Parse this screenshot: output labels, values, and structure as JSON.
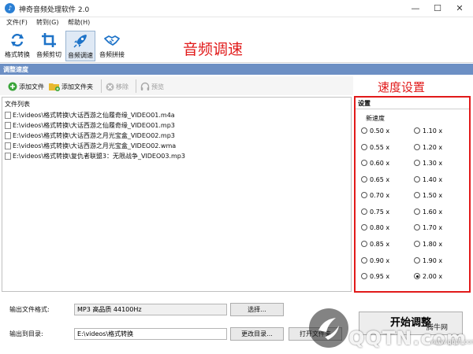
{
  "window": {
    "title": "神奇音频处理软件 2.0",
    "minimize": "—",
    "maximize": "☐",
    "close": "✕"
  },
  "menu": [
    "文件(F)",
    "转到(G)",
    "帮助(H)"
  ],
  "toolbar": {
    "tools": [
      {
        "label": "格式转换",
        "icon": "convert-icon"
      },
      {
        "label": "音频剪切",
        "icon": "crop-icon"
      },
      {
        "label": "音频调速",
        "icon": "rocket-icon",
        "active": true
      },
      {
        "label": "音频拼接",
        "icon": "handshake-icon"
      }
    ]
  },
  "annotations": {
    "title": "音频调速",
    "speed": "速度设置",
    "color": "#e11a1a"
  },
  "section": {
    "title": "调整速度"
  },
  "file_toolbar": {
    "add_file": "添加文件",
    "add_folder": "添加文件夹",
    "remove": "移除",
    "preview": "预览"
  },
  "file_list": {
    "header": "文件列表",
    "files": [
      "E:\\videos\\格式转换\\大话西游之仙履奇缘_VIDEO01.m4a",
      "E:\\videos\\格式转换\\大话西游之仙履奇缘_VIDEO01.mp3",
      "E:\\videos\\格式转换\\大话西游之月光宝盒_VIDEO02.mp3",
      "E:\\videos\\格式转换\\大话西游之月光宝盒_VIDEO02.wma",
      "E:\\videos\\格式转换\\复仇者联盟3：无限战争_VIDEO03.mp3"
    ]
  },
  "settings": {
    "title": "设置",
    "speed_label": "新速度",
    "left_options": [
      "0.50 x",
      "0.55 x",
      "0.60 x",
      "0.65 x",
      "0.70 x",
      "0.75 x",
      "0.80 x",
      "0.85 x",
      "0.90 x",
      "0.95 x"
    ],
    "right_options": [
      "1.10 x",
      "1.20 x",
      "1.30 x",
      "1.40 x",
      "1.50 x",
      "1.60 x",
      "1.70 x",
      "1.80 x",
      "1.90 x",
      "2.00 x"
    ],
    "selected": "2.00 x"
  },
  "output": {
    "format_label": "输出文件格式:",
    "format_value": "MP3 高品质 44100Hz",
    "select_button": "选择...",
    "dir_label": "输出到目录:",
    "dir_value": "E:\\videos\\格式转换",
    "change_dir_button": "更改目录...",
    "open_dir_button": "打开文件夹"
  },
  "start_button": "开始调整",
  "watermark": {
    "text": "QQTN.com",
    "cn": "腾牛网",
    "url": "www.qqtn.com"
  }
}
